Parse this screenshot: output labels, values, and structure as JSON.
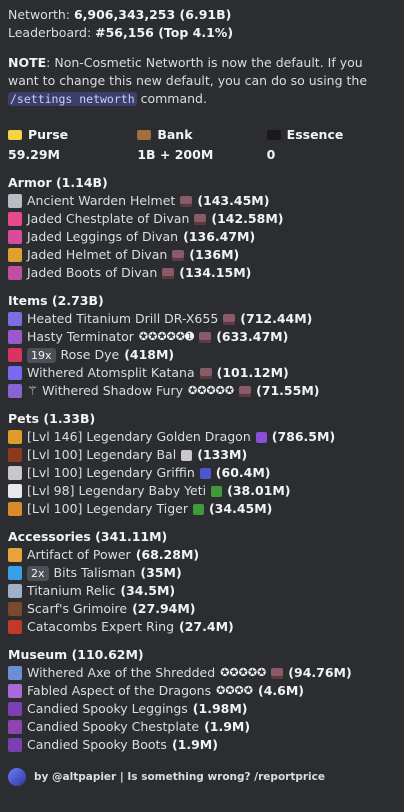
{
  "header": {
    "networth_label": "Networth: ",
    "networth_value": "6,906,343,253 (6.91B)",
    "leaderboard_label": "Leaderboard: ",
    "leaderboard_value": "#56,156 (Top 4.1%)"
  },
  "note": {
    "label": "NOTE",
    "text_before": ": Non-Cosmetic Networth is now the default. If you want to change this new default, you can do so using the ",
    "command": "/settings networth",
    "text_after": " command."
  },
  "stats": [
    {
      "label": "Purse",
      "value": "59.29M",
      "icon": "gold-ingot-icon",
      "color": "#f5d442"
    },
    {
      "label": "Bank",
      "value": "1B + 200M",
      "icon": "chest-icon",
      "color": "#a0703a"
    },
    {
      "label": "Essence",
      "value": "0",
      "icon": "essence-icon",
      "color": "#1a1a1a"
    }
  ],
  "sections": [
    {
      "title": "Armor (1.14B)",
      "items": [
        {
          "name": "Ancient Warden Helmet",
          "value": "(143.45M)",
          "badge": "",
          "stars": "",
          "prefix": "",
          "icon_color": "#b9bcc2",
          "chest": true
        },
        {
          "name": "Jaded Chestplate of Divan",
          "value": "(142.58M)",
          "badge": "",
          "stars": "",
          "prefix": "",
          "icon_color": "#e64a8a",
          "chest": true
        },
        {
          "name": "Jaded Leggings of Divan",
          "value": "(136.47M)",
          "badge": "",
          "stars": "",
          "prefix": "",
          "icon_color": "#d94c9c",
          "chest": false
        },
        {
          "name": "Jaded Helmet of Divan",
          "value": "(136M)",
          "badge": "",
          "stars": "",
          "prefix": "",
          "icon_color": "#e0a030",
          "chest": true
        },
        {
          "name": "Jaded Boots of Divan",
          "value": "(134.15M)",
          "badge": "",
          "stars": "",
          "prefix": "",
          "icon_color": "#c04fa0",
          "chest": true
        }
      ]
    },
    {
      "title": "Items (2.73B)",
      "items": [
        {
          "name": "Heated Titanium Drill DR-X655",
          "value": "(712.44M)",
          "badge": "",
          "stars": "",
          "prefix": "",
          "icon_color": "#7a6ee0",
          "chest": true
        },
        {
          "name": "Hasty Terminator",
          "value": "(633.47M)",
          "badge": "",
          "stars": "✪✪✪✪✪➊",
          "prefix": "",
          "icon_color": "#9b59d0",
          "chest": true
        },
        {
          "name": "Rose Dye",
          "value": "(418M)",
          "badge": "19x",
          "stars": "",
          "prefix": "",
          "icon_color": "#d8345f",
          "chest": false
        },
        {
          "name": "Withered Atomsplit Katana",
          "value": "(101.12M)",
          "badge": "",
          "stars": "",
          "prefix": "",
          "icon_color": "#7b68ee",
          "chest": true
        },
        {
          "name": "Withered Shadow Fury",
          "value": "(71.55M)",
          "badge": "",
          "stars": "✪✪✪✪✪",
          "prefix": "⚚ ",
          "icon_color": "#8a63d2",
          "chest": true
        }
      ]
    },
    {
      "title": "Pets (1.33B)",
      "items": [
        {
          "name": "[Lvl 146] Legendary Golden Dragon",
          "value": "(786.5M)",
          "badge": "",
          "stars": "",
          "prefix": "",
          "icon_color": "#e09b2d",
          "chest": false,
          "held": "#8a4fd6"
        },
        {
          "name": "[Lvl 100] Legendary Bal",
          "value": "(133M)",
          "badge": "",
          "stars": "",
          "prefix": "",
          "icon_color": "#8b3a1e",
          "chest": false,
          "held": "#c9c9c9"
        },
        {
          "name": "[Lvl 100] Legendary Griffin",
          "value": "(60.4M)",
          "badge": "",
          "stars": "",
          "prefix": "",
          "icon_color": "#c8c8c8",
          "chest": false,
          "held": "#4a56c9"
        },
        {
          "name": "[Lvl 98] Legendary Baby Yeti",
          "value": "(38.01M)",
          "badge": "",
          "stars": "",
          "prefix": "",
          "icon_color": "#e8e8e8",
          "chest": false,
          "held": "#3f9b3a"
        },
        {
          "name": "[Lvl 100] Legendary Tiger",
          "value": "(34.45M)",
          "badge": "",
          "stars": "",
          "prefix": "",
          "icon_color": "#d98a2b",
          "chest": false,
          "held": "#3f9b3a"
        }
      ]
    },
    {
      "title": "Accessories (341.11M)",
      "items": [
        {
          "name": "Artifact of Power",
          "value": "(68.28M)",
          "badge": "",
          "stars": "",
          "prefix": "",
          "icon_color": "#e6a43a",
          "chest": false
        },
        {
          "name": "Bits Talisman",
          "value": "(35M)",
          "badge": "2x",
          "stars": "",
          "prefix": "",
          "icon_color": "#3aa0e6",
          "chest": false
        },
        {
          "name": "Titanium Relic",
          "value": "(34.5M)",
          "badge": "",
          "stars": "",
          "prefix": "",
          "icon_color": "#9fb0c4",
          "chest": false
        },
        {
          "name": "Scarf's Grimoire",
          "value": "(27.94M)",
          "badge": "",
          "stars": "",
          "prefix": "",
          "icon_color": "#7a4a2a",
          "chest": false
        },
        {
          "name": "Catacombs Expert Ring",
          "value": "(27.4M)",
          "badge": "",
          "stars": "",
          "prefix": "",
          "icon_color": "#c0392b",
          "chest": false
        }
      ]
    },
    {
      "title": "Museum (110.62M)",
      "items": [
        {
          "name": "Withered Axe of the Shredded",
          "value": "(94.76M)",
          "badge": "",
          "stars": "✪✪✪✪✪",
          "prefix": "",
          "icon_color": "#6b8ed6",
          "chest": true
        },
        {
          "name": "Fabled Aspect of the Dragons",
          "value": "(4.6M)",
          "badge": "",
          "stars": "✪✪✪✪",
          "prefix": "",
          "icon_color": "#a86ad8",
          "chest": false
        },
        {
          "name": "Candied Spooky Leggings",
          "value": "(1.98M)",
          "badge": "",
          "stars": "",
          "prefix": "",
          "icon_color": "#7a3fb0",
          "chest": false
        },
        {
          "name": "Candied Spooky Chestplate",
          "value": "(1.9M)",
          "badge": "",
          "stars": "",
          "prefix": "",
          "icon_color": "#8e44ad",
          "chest": false
        },
        {
          "name": "Candied Spooky Boots",
          "value": "(1.9M)",
          "badge": "",
          "stars": "",
          "prefix": "",
          "icon_color": "#7a3fb0",
          "chest": false
        }
      ]
    }
  ],
  "footer": {
    "text": "by @altpapier | Is something wrong? /reportprice"
  }
}
